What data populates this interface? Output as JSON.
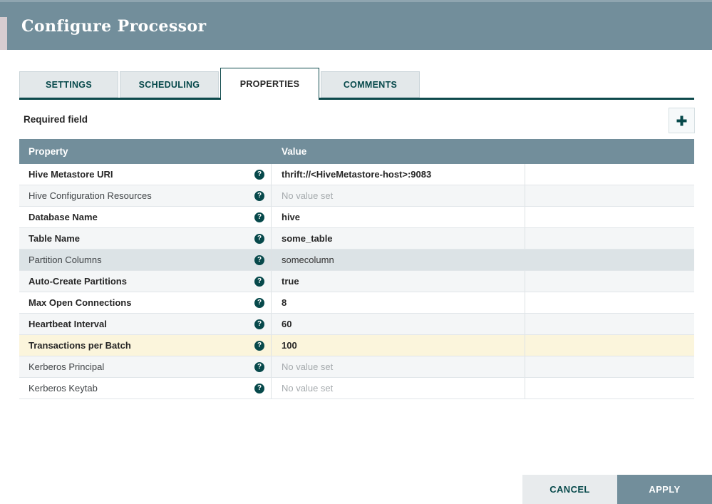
{
  "dialog": {
    "title": "Configure Processor"
  },
  "tabs": [
    {
      "label": "SETTINGS",
      "active": false
    },
    {
      "label": "SCHEDULING",
      "active": false
    },
    {
      "label": "PROPERTIES",
      "active": true
    },
    {
      "label": "COMMENTS",
      "active": false
    }
  ],
  "properties_panel": {
    "legend": "Required field",
    "add_button_icon": "plus-icon"
  },
  "icons": {
    "help_glyph": "?",
    "plus_glyph": "+"
  },
  "table": {
    "columns": [
      "Property",
      "Value"
    ],
    "rows": [
      {
        "property": "Hive Metastore URI",
        "required": true,
        "value": "thrift://<HiveMetastore-host>:9083",
        "value_set": true,
        "highlight": "none"
      },
      {
        "property": "Hive Configuration Resources",
        "required": false,
        "value": "No value set",
        "value_set": false,
        "highlight": "none"
      },
      {
        "property": "Database Name",
        "required": true,
        "value": "hive",
        "value_set": true,
        "highlight": "none"
      },
      {
        "property": "Table Name",
        "required": true,
        "value": "some_table",
        "value_set": true,
        "highlight": "none"
      },
      {
        "property": "Partition Columns",
        "required": false,
        "value": "somecolumn",
        "value_set": true,
        "highlight": "selected"
      },
      {
        "property": "Auto-Create Partitions",
        "required": true,
        "value": "true",
        "value_set": true,
        "highlight": "none"
      },
      {
        "property": "Max Open Connections",
        "required": true,
        "value": "8",
        "value_set": true,
        "highlight": "none"
      },
      {
        "property": "Heartbeat Interval",
        "required": true,
        "value": "60",
        "value_set": true,
        "highlight": "none"
      },
      {
        "property": "Transactions per Batch",
        "required": true,
        "value": "100",
        "value_set": true,
        "highlight": "modified"
      },
      {
        "property": "Kerberos Principal",
        "required": false,
        "value": "No value set",
        "value_set": false,
        "highlight": "none"
      },
      {
        "property": "Kerberos Keytab",
        "required": false,
        "value": "No value set",
        "value_set": false,
        "highlight": "none"
      }
    ]
  },
  "footer": {
    "cancel_label": "CANCEL",
    "apply_label": "APPLY"
  },
  "colors": {
    "header_slate": "#728E9B",
    "accent_teal": "#004849",
    "tab_inactive_bg": "#E3E8EA",
    "row_alt": "#F4F6F7",
    "row_selected": "#DCE3E6",
    "row_modified": "#FBF5DC",
    "value_unset_text": "#A5AAAD",
    "cancel_bg": "#E8EBED",
    "apply_bg": "#728E9B"
  }
}
